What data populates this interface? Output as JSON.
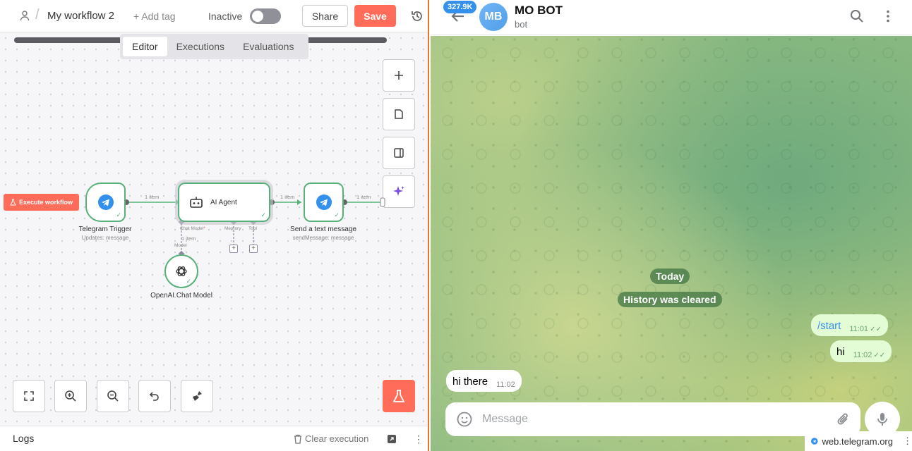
{
  "n8n": {
    "workflow_title": "My workflow 2",
    "add_tag": "+ Add tag",
    "active_label": "Inactive",
    "share": "Share",
    "save": "Save",
    "tabs": [
      {
        "label": "Editor",
        "active": true
      },
      {
        "label": "Executions",
        "active": false
      },
      {
        "label": "Evaluations",
        "active": false
      }
    ],
    "execute_workflow": "Execute workflow",
    "nodes": {
      "trigger": {
        "label": "Telegram Trigger",
        "sub": "Updates: message"
      },
      "agent": {
        "label": "AI Agent"
      },
      "send": {
        "label": "Send a text message",
        "sub": "sendMessage: message"
      },
      "model": {
        "label": "OpenAI Chat Model"
      }
    },
    "connections": {
      "c1": "1 item",
      "c2": "1 item",
      "c3": "1 item",
      "model_link": "1 item",
      "model_port": "Model"
    },
    "ports": {
      "chat_model": "Chat Model",
      "chat_model_req": "*",
      "memory": "Memory",
      "tool": "Tool"
    },
    "logs": "Logs",
    "clear_execution": "Clear execution",
    "colors": {
      "accent": "#ff6d5a",
      "node_border": "#58b17a",
      "telegram": "#3390ec"
    }
  },
  "telegram": {
    "badge": "327.9K",
    "avatar_initials": "MB",
    "chat_name": "MO BOT",
    "chat_status": "bot",
    "date_pill": "Today",
    "service_msg": "History was cleared",
    "messages": [
      {
        "text": "/start",
        "time": "11:01",
        "dir": "out",
        "link": true
      },
      {
        "text": "hi",
        "time": "11:02",
        "dir": "out"
      },
      {
        "text": "hi there",
        "time": "11:02",
        "dir": "in"
      }
    ],
    "composer_placeholder": "Message",
    "domain_label": "web.telegram.org",
    "colors": {
      "accent": "#3390ec",
      "out_bubble": "#e3fcd6"
    }
  }
}
